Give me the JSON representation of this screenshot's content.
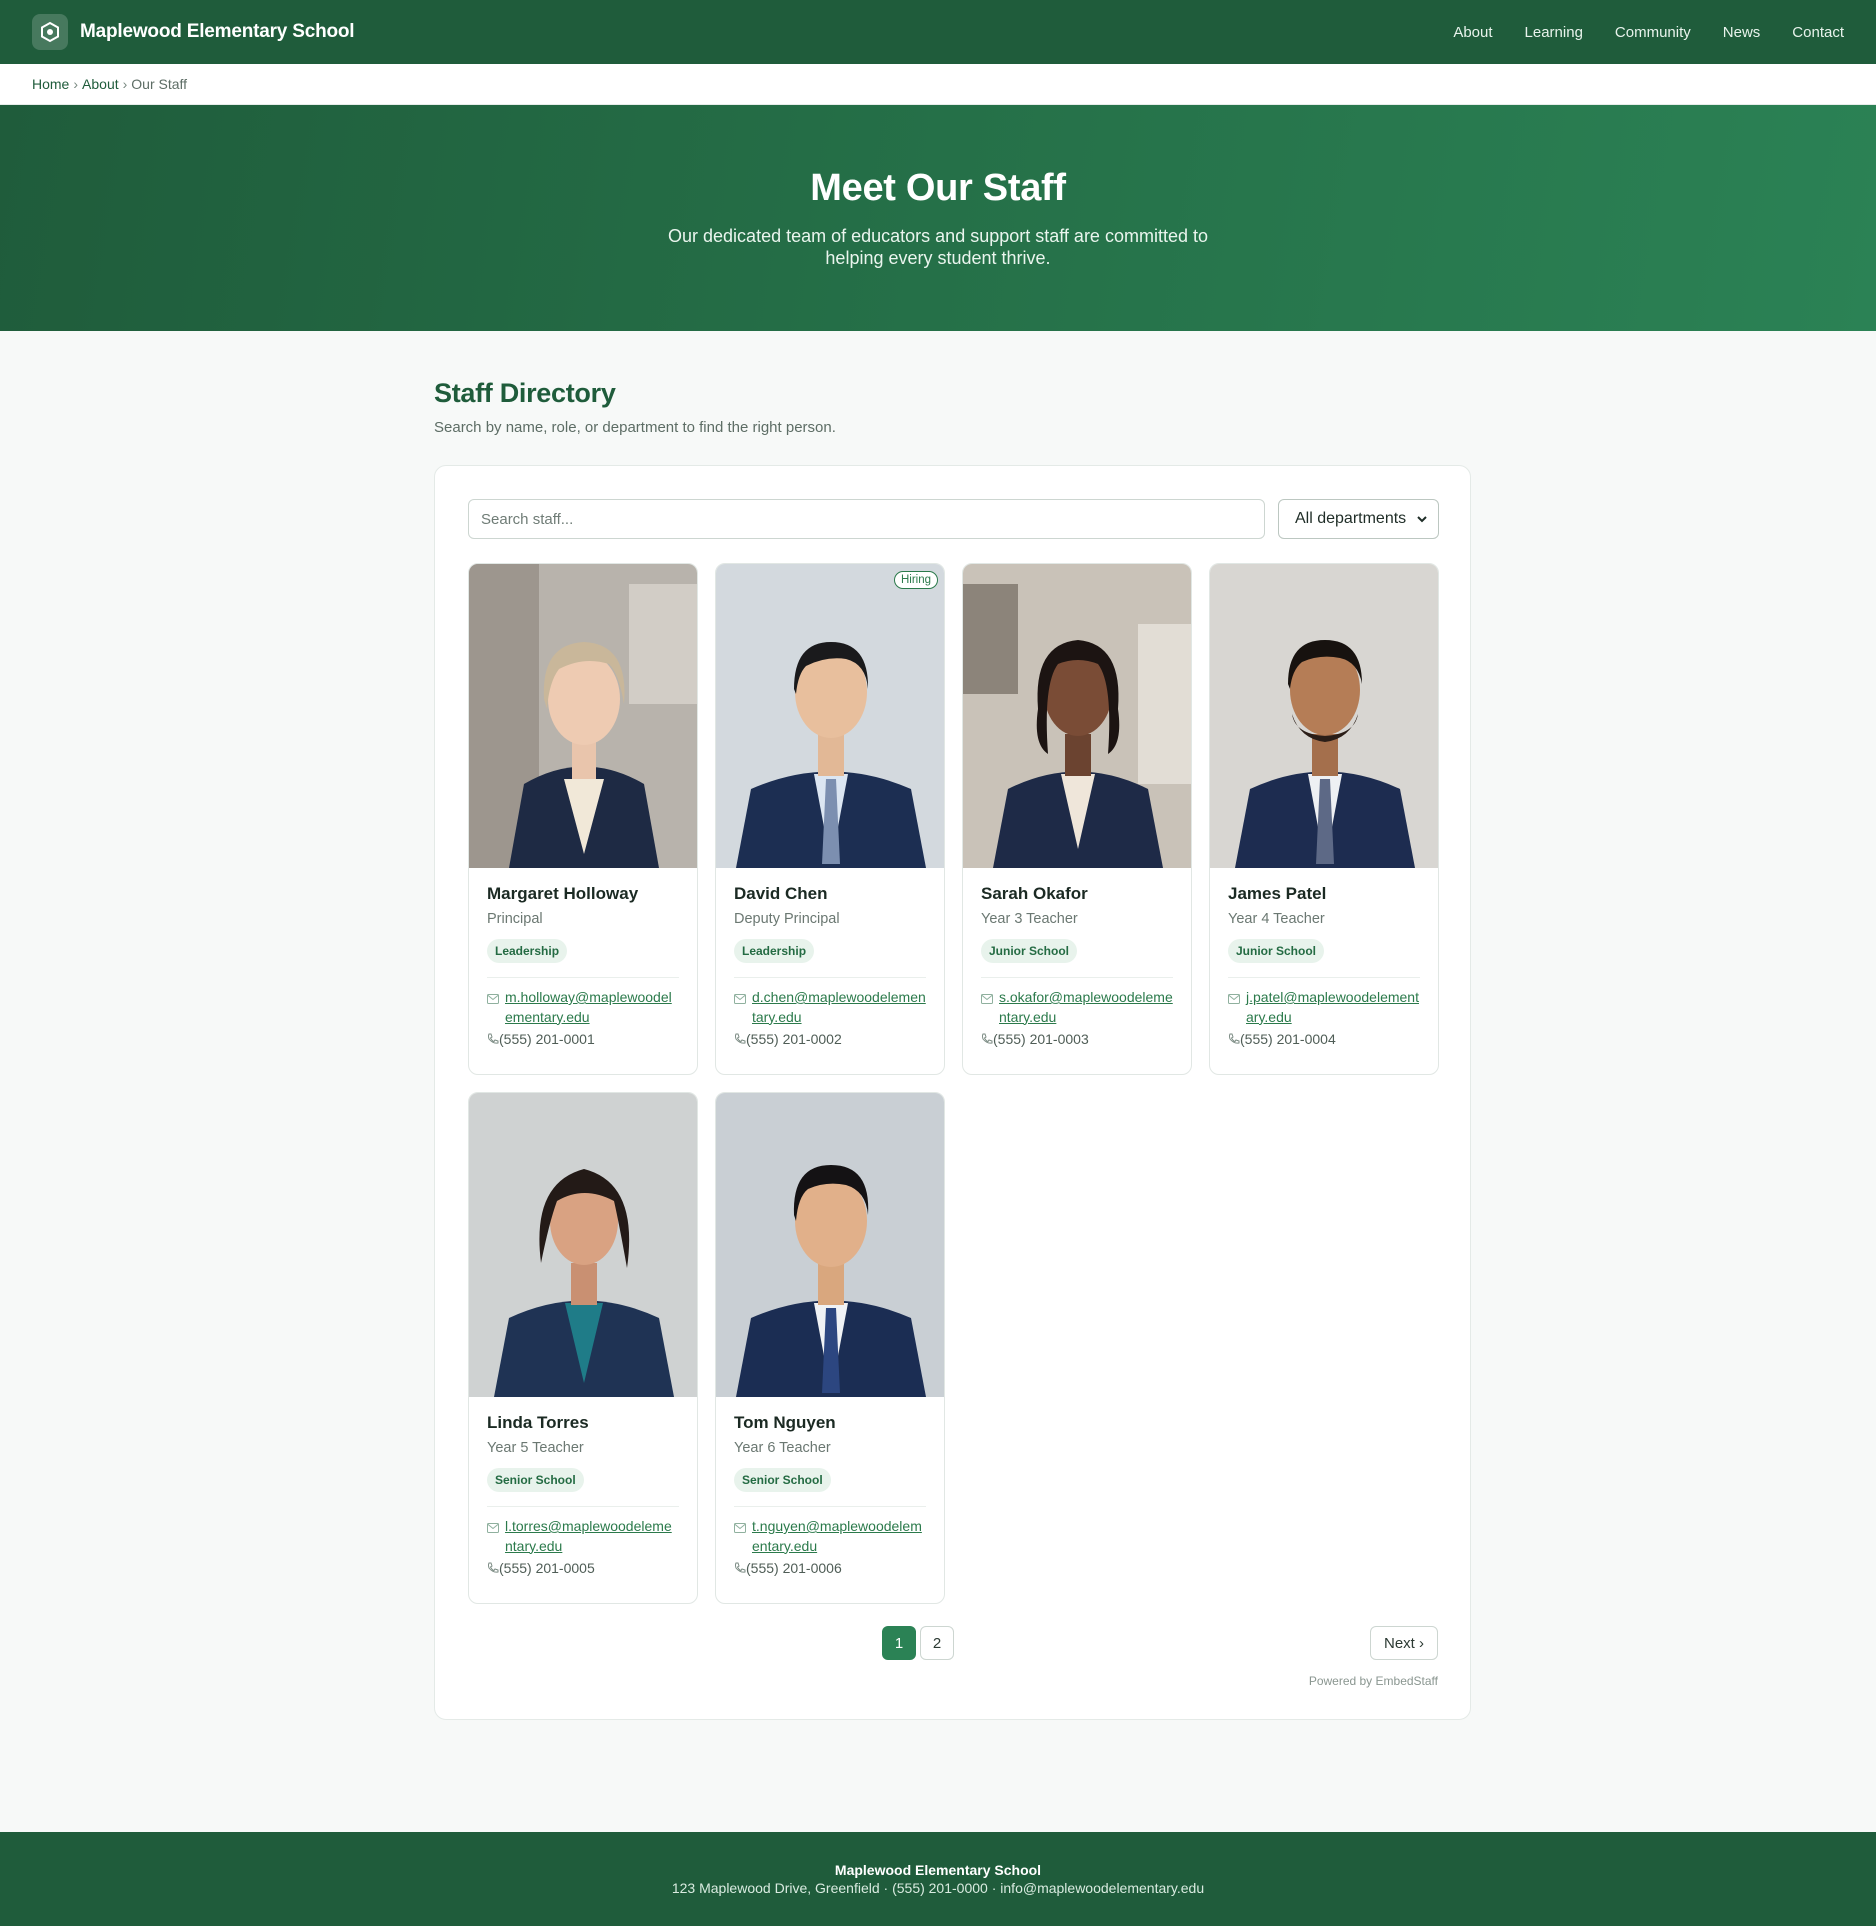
{
  "header": {
    "brand": "Maplewood Elementary School",
    "nav": [
      "About",
      "Learning",
      "Community",
      "News",
      "Contact"
    ]
  },
  "breadcrumb": {
    "home": "Home",
    "about": "About",
    "current": "Our Staff",
    "sep": "›"
  },
  "hero": {
    "title": "Meet Our Staff",
    "subtitle": "Our dedicated team of educators and support staff are committed to helping every student thrive."
  },
  "directory": {
    "title": "Staff Directory",
    "subtitle": "Search by name, role, or department to find the right person.",
    "search_placeholder": "Search staff...",
    "department_selected": "All departments"
  },
  "staff": [
    {
      "name": "Margaret Holloway",
      "role": "Principal",
      "department": "Leadership",
      "email": "m.holloway@maplewoodelementary.edu",
      "phone": "(555) 201-0001",
      "badge": ""
    },
    {
      "name": "David Chen",
      "role": "Deputy Principal",
      "department": "Leadership",
      "email": "d.chen@maplewoodelementary.edu",
      "phone": "(555) 201-0002",
      "badge": "Hiring"
    },
    {
      "name": "Sarah Okafor",
      "role": "Year 3 Teacher",
      "department": "Junior School",
      "email": "s.okafor@maplewoodelementary.edu",
      "phone": "(555) 201-0003",
      "badge": ""
    },
    {
      "name": "James Patel",
      "role": "Year 4 Teacher",
      "department": "Junior School",
      "email": "j.patel@maplewoodelementary.edu",
      "phone": "(555) 201-0004",
      "badge": ""
    },
    {
      "name": "Linda Torres",
      "role": "Year 5 Teacher",
      "department": "Senior School",
      "email": "l.torres@maplewoodelementary.edu",
      "phone": "(555) 201-0005",
      "badge": ""
    },
    {
      "name": "Tom Nguyen",
      "role": "Year 6 Teacher",
      "department": "Senior School",
      "email": "t.nguyen@maplewoodelementary.edu",
      "phone": "(555) 201-0006",
      "badge": ""
    }
  ],
  "pagination": {
    "page1": "1",
    "page2": "2",
    "next": "Next ›"
  },
  "powered_by": "Powered by EmbedStaff",
  "footer": {
    "name": "Maplewood Elementary School",
    "address": "123 Maplewood Drive, Greenfield",
    "phone": "(555) 201-0000",
    "email": "info@maplewoodelementary.edu",
    "sep": "·"
  },
  "colors": {
    "primary": "#1f5c3b",
    "accent": "#2b8255",
    "tag_bg": "#e8f3ec"
  }
}
